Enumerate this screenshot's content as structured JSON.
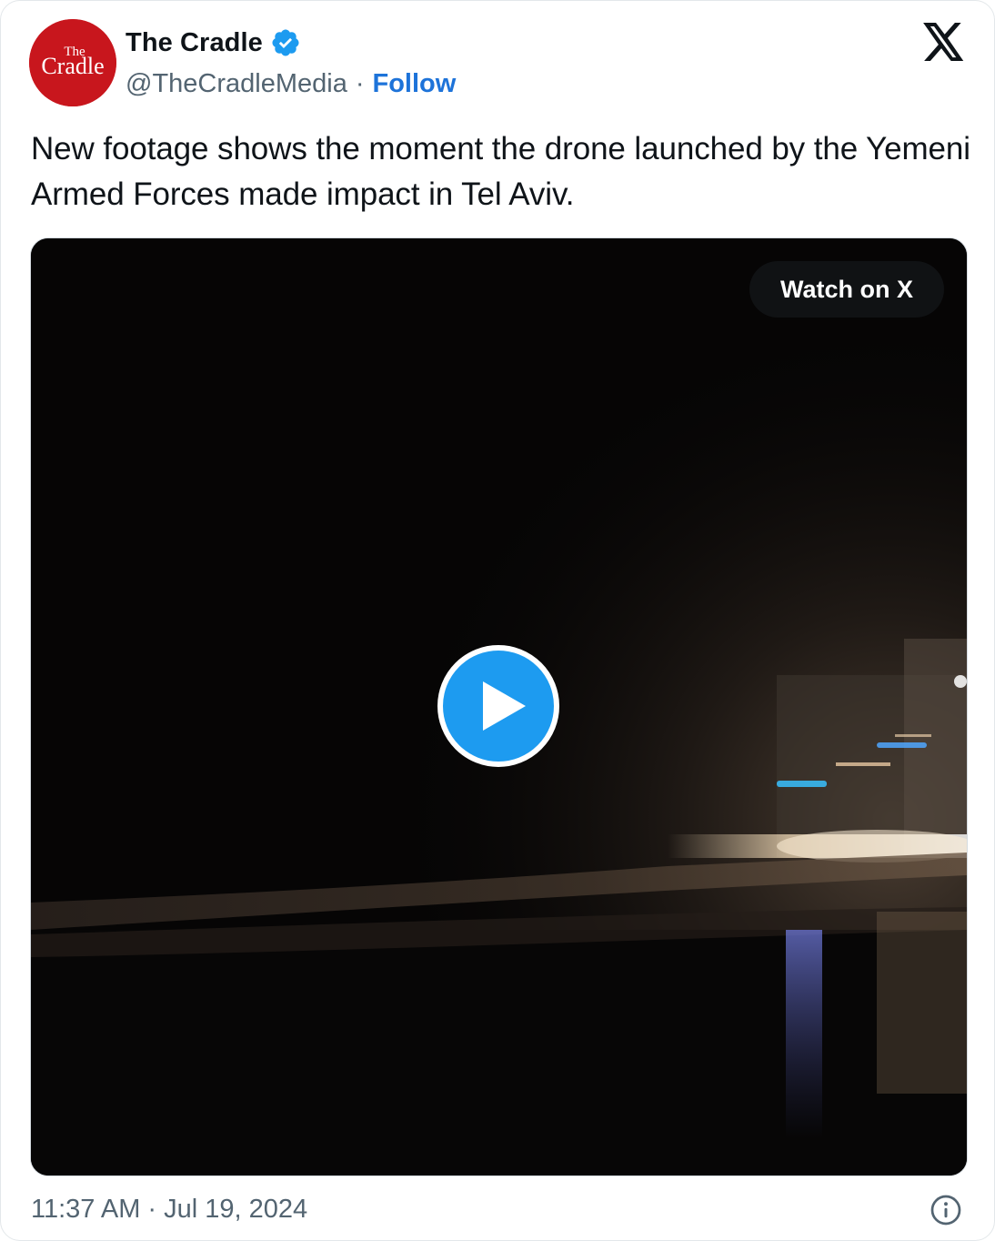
{
  "account": {
    "display_name": "The Cradle",
    "handle": "@TheCradleMedia",
    "separator": "·",
    "follow_label": "Follow",
    "avatar_logo_text_top": "The",
    "avatar_logo_text_main": "Cradle",
    "verified": true,
    "icon": "verified-badge-icon"
  },
  "header": {
    "platform_icon": "x-logo-icon"
  },
  "tweet": {
    "text": "New footage shows the moment the drone launched by the Yemeni Armed Forces made impact in Tel Aviv."
  },
  "media": {
    "type": "video",
    "watch_label": "Watch on X",
    "play_icon": "play-icon"
  },
  "footer": {
    "timestamp": "11:37 AM · Jul 19, 2024",
    "info_icon": "info-icon"
  },
  "colors": {
    "avatar_bg": "#c8161d",
    "verified_blue": "#1d9bf0",
    "follow_link": "#1d73d9",
    "play_button": "#1d9bf0",
    "muted_text": "#536471"
  }
}
